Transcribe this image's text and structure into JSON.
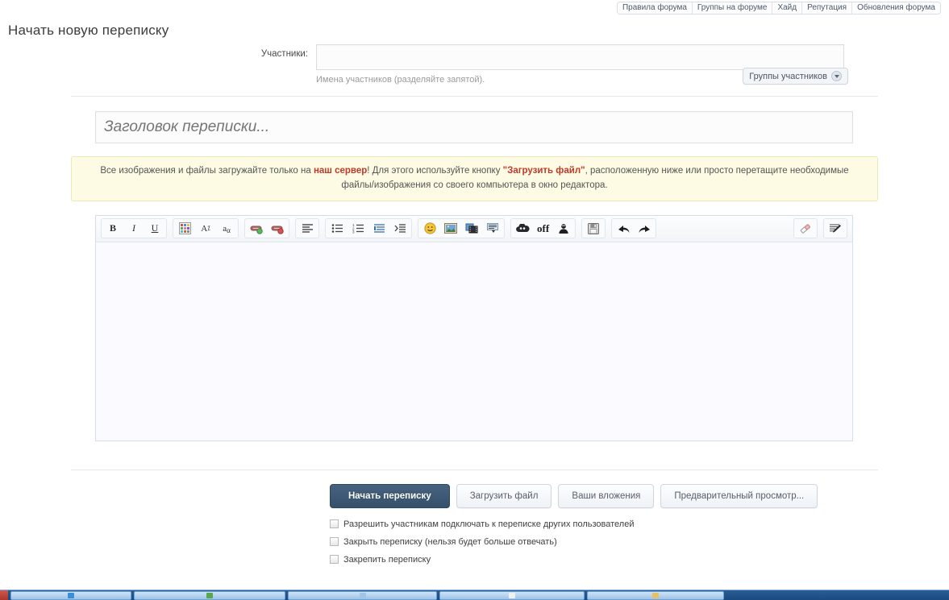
{
  "topnav": {
    "items": [
      {
        "label": "Правила форума",
        "name": "topnav-forum-rules"
      },
      {
        "label": "Группы на форуме",
        "name": "topnav-forum-groups"
      },
      {
        "label": "Хайд",
        "name": "topnav-hide"
      },
      {
        "label": "Репутация",
        "name": "topnav-reputation"
      },
      {
        "label": "Обновления форума",
        "name": "topnav-forum-updates"
      }
    ]
  },
  "page": {
    "title": "Начать новую переписку"
  },
  "participants": {
    "label": "Участники:",
    "value": "",
    "placeholder": "",
    "hint": "Имена участников (разделяйте запятой).",
    "groups_button": "Группы участников"
  },
  "conversation_title": {
    "value": "",
    "placeholder": "Заголовок переписки..."
  },
  "notice": {
    "part1": "Все изображения и файлы загружайте только на ",
    "emphasis1": "наш сервер",
    "part2": "! Для этого используйте кнопку ",
    "emphasis2": "\"Загрузить файл\"",
    "part3": ", расположенную ниже или просто перетащите необходимые файлы/изображения со своего компьютера в окно редактора."
  },
  "editor": {
    "toolbar_groups": [
      {
        "name": "text-format-group",
        "buttons": [
          {
            "name": "bold-icon",
            "label": "B"
          },
          {
            "name": "italic-icon",
            "label": "I"
          },
          {
            "name": "underline-icon",
            "label": "U"
          }
        ]
      },
      {
        "name": "text-style-group",
        "buttons": [
          {
            "name": "text-color-icon",
            "label": ""
          },
          {
            "name": "font-size-icon",
            "label": "A"
          },
          {
            "name": "font-family-icon",
            "label": "a"
          }
        ]
      },
      {
        "name": "link-group",
        "buttons": [
          {
            "name": "insert-link-icon",
            "label": ""
          },
          {
            "name": "remove-link-icon",
            "label": ""
          }
        ]
      },
      {
        "name": "align-group",
        "buttons": [
          {
            "name": "align-left-icon",
            "label": ""
          }
        ]
      },
      {
        "name": "list-group",
        "buttons": [
          {
            "name": "bullet-list-icon",
            "label": ""
          },
          {
            "name": "numbered-list-icon",
            "label": ""
          },
          {
            "name": "quote-icon",
            "label": ""
          },
          {
            "name": "code-icon",
            "label": ""
          }
        ]
      },
      {
        "name": "media-group",
        "buttons": [
          {
            "name": "smiley-icon",
            "label": ""
          },
          {
            "name": "image-icon",
            "label": ""
          },
          {
            "name": "video-icon",
            "label": ""
          },
          {
            "name": "spoiler-icon",
            "label": ""
          }
        ]
      },
      {
        "name": "hide-group",
        "buttons": [
          {
            "name": "cloud-icon",
            "label": ""
          },
          {
            "name": "off-label",
            "label": "off"
          },
          {
            "name": "user-hide-icon",
            "label": ""
          }
        ]
      },
      {
        "name": "save-group",
        "buttons": [
          {
            "name": "save-draft-icon",
            "label": ""
          }
        ]
      },
      {
        "name": "history-group",
        "buttons": [
          {
            "name": "undo-icon",
            "label": ""
          },
          {
            "name": "redo-icon",
            "label": ""
          }
        ]
      }
    ],
    "right_buttons": [
      {
        "name": "eraser-icon",
        "label": ""
      },
      {
        "name": "source-mode-icon",
        "label": ""
      }
    ],
    "content": ""
  },
  "actions": {
    "submit": "Начать переписку",
    "upload_file": "Загрузить файл",
    "your_attachments": "Ваши вложения",
    "preview": "Предварительный просмотр..."
  },
  "options": [
    {
      "label": "Разрешить участникам подключать к переписке других пользователей",
      "name": "allow-invite-checkbox",
      "checked": false
    },
    {
      "label": "Закрыть переписку (нельзя будет больше отвечать)",
      "name": "lock-conversation-checkbox",
      "checked": false
    },
    {
      "label": "Закрепить переписку",
      "name": "pin-conversation-checkbox",
      "checked": false
    }
  ],
  "colors": {
    "primary_button": "#3b5770",
    "notice_bg": "#fdfbe4",
    "notice_border": "#ece9b8",
    "accent_red": "#c0392b",
    "taskbar": "#1b4a80"
  }
}
